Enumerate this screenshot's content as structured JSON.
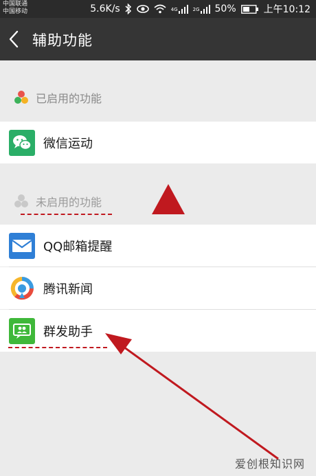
{
  "status_bar": {
    "carrier_1": "中国联通",
    "carrier_2": "中国移动",
    "speed": "5.6K/s",
    "net_1": "4G",
    "net_2": "2G",
    "battery": "50%",
    "time": "上午10:12"
  },
  "header": {
    "title": "辅助功能"
  },
  "enabled_section": {
    "label": "已启用的功能",
    "items": [
      {
        "label": "微信运动",
        "icon": "wechat-icon"
      }
    ]
  },
  "disabled_section": {
    "label": "未启用的功能",
    "items": [
      {
        "label": "QQ邮箱提醒",
        "icon": "mail-icon"
      },
      {
        "label": "腾讯新闻",
        "icon": "tencent-news-icon"
      },
      {
        "label": "群发助手",
        "icon": "broadcast-icon"
      }
    ]
  },
  "watermark": {
    "text": "爱创根知识网"
  },
  "colors": {
    "titlebar": "#353535",
    "annotation": "#c0191f",
    "wechat_green": "#2aae67"
  }
}
